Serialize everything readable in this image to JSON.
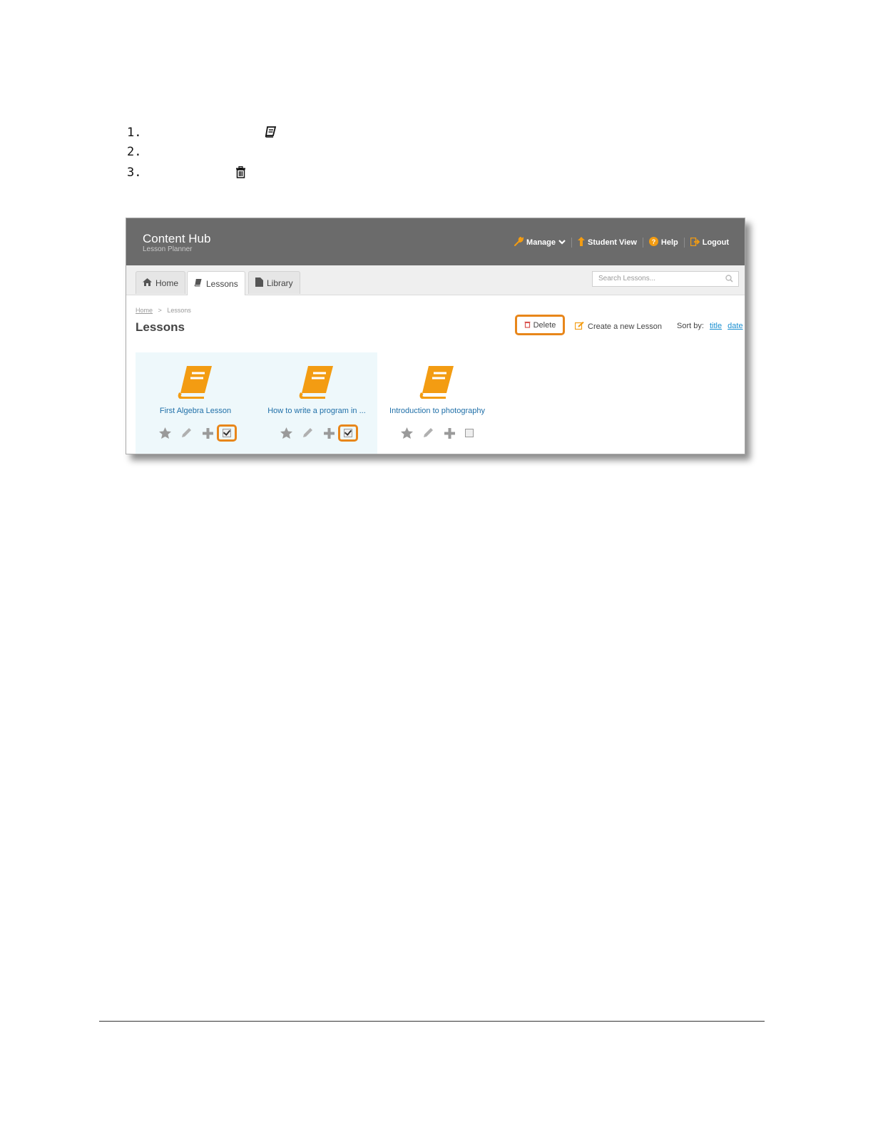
{
  "steps": [
    {
      "number": "1.",
      "icon": "book-icon"
    },
    {
      "number": "2.",
      "icon": ""
    },
    {
      "number": "3.",
      "icon": "trash-icon"
    }
  ],
  "app": {
    "title": "Content Hub",
    "subtitle": "Lesson Planner",
    "nav": {
      "manage": "Manage",
      "student_view": "Student View",
      "help": "Help",
      "logout": "Logout"
    },
    "tabs": [
      {
        "label": "Home",
        "icon": "home-icon"
      },
      {
        "label": "Lessons",
        "icon": "book-icon",
        "active": true
      },
      {
        "label": "Library",
        "icon": "document-icon"
      }
    ],
    "search_placeholder": "Search Lessons...",
    "breadcrumb": {
      "home": "Home",
      "separator": ">",
      "current": "Lessons"
    },
    "page_title": "Lessons",
    "toolbar": {
      "delete_label": "Delete",
      "create_label": "Create a new Lesson",
      "sort_label": "Sort by:",
      "sort_title": "title",
      "sort_date": "date"
    },
    "lessons": [
      {
        "title": "First Algebra Lesson",
        "checked": true
      },
      {
        "title": "How to write a program in ...",
        "checked": true
      },
      {
        "title": "Introduction to photography",
        "checked": false
      }
    ]
  },
  "colors": {
    "header_bg": "#6b6b6b",
    "accent_orange": "#f39c12",
    "highlight_orange": "#e8861a",
    "link_blue": "#1f6fa8",
    "selected_card_bg": "#eef8fb"
  }
}
